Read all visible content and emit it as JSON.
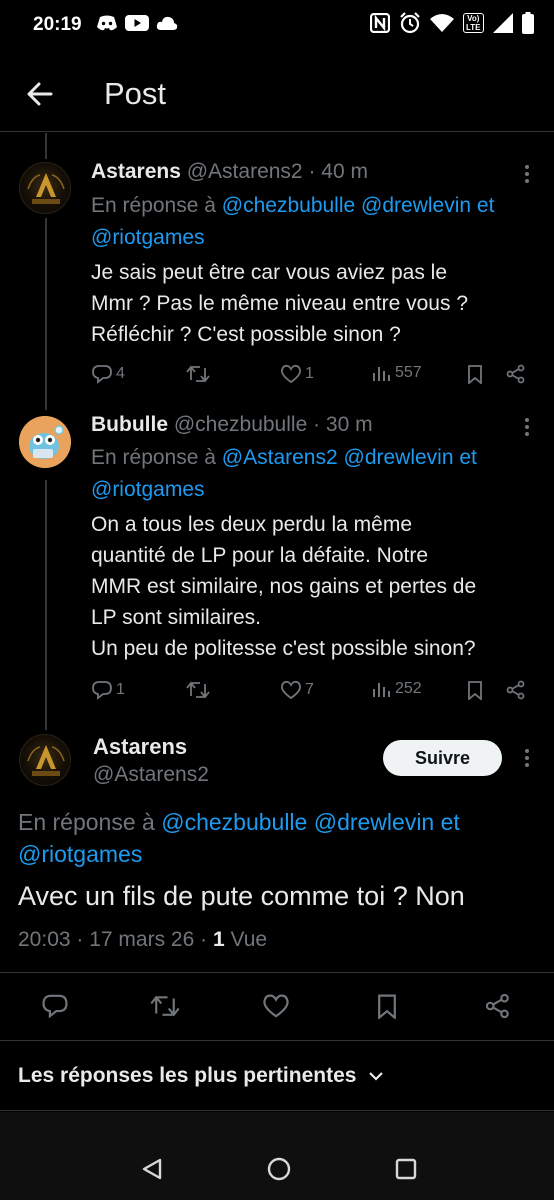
{
  "status_bar": {
    "time": "20:19",
    "left_icons": [
      "discord-icon",
      "youtube-icon",
      "cloud-icon"
    ],
    "right_icons": [
      "nfc-icon",
      "alarm-icon",
      "wifi-icon",
      "volte-icon",
      "signal-icon",
      "battery-icon"
    ],
    "volte_label_1": "Vo)",
    "volte_label_2": "LTE"
  },
  "header": {
    "title": "Post",
    "back_icon": "back-arrow-icon"
  },
  "replies": [
    {
      "name": "Astarens",
      "handle": "@Astarens2",
      "time": "· 40 m",
      "reply_prefix": "En réponse à",
      "mention_1": "@chezbubulle",
      "mention_2": "@drewlevin",
      "conj": "et",
      "mention_3": "@riotgames",
      "text_lines": [
        "Je sais peut être car vous aviez pas le",
        "Mmr ? Pas le même niveau entre vous ?",
        "Réfléchir ? C'est possible sinon ?"
      ],
      "replies_count": "4",
      "likes": "1",
      "views": "557"
    },
    {
      "name": "Bubulle",
      "handle": "@chezbubulle",
      "time": "· 30 m",
      "reply_prefix": "En réponse à",
      "mention_1": "@Astarens2",
      "mention_2": "@drewlevin",
      "conj": "et",
      "mention_3": "@riotgames",
      "text_lines": [
        "On a tous les deux perdu la même",
        "quantité de LP pour la défaite. Notre",
        "MMR est similaire, nos gains et pertes de",
        "LP sont similaires.",
        "Un peu de politesse c'est possible sinon?"
      ],
      "replies_count": "1",
      "likes": "7",
      "views": "252"
    }
  ],
  "main_post": {
    "name": "Astarens",
    "handle": "@Astarens2",
    "follow_label": "Suivre",
    "reply_prefix": "En réponse à",
    "mention_1": "@chezbubulle",
    "mention_2": "@drewlevin",
    "conj": "et",
    "mention_3": "@riotgames",
    "text": "Avec un fils de pute comme toi ? Non",
    "datetime": "20:03 · 17 mars 26 ·",
    "views_count": "1",
    "views_label": "Vue"
  },
  "sort": {
    "label": "Les réponses les plus pertinentes"
  },
  "colors": {
    "background": "#000000",
    "link": "#1d9bf0",
    "muted": "#71767b",
    "text": "#e7e9ea"
  }
}
